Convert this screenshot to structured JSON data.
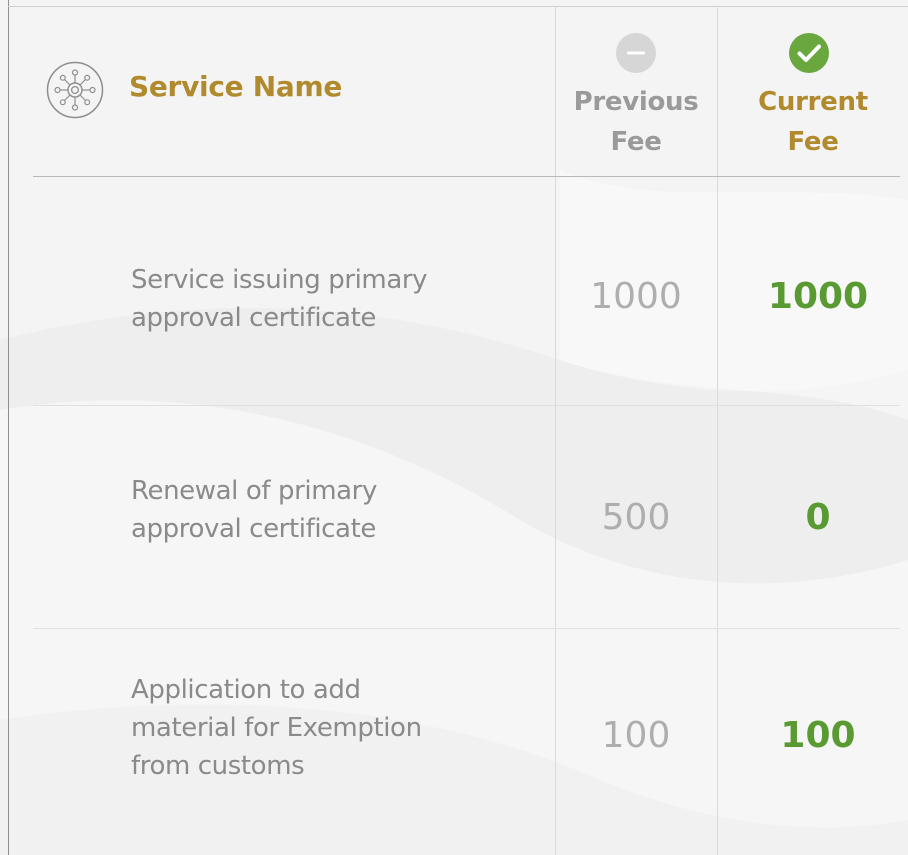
{
  "header": {
    "service_label": "Service Name",
    "previous_fee_label": [
      "Previous",
      "Fee"
    ],
    "current_fee_label": [
      "Current",
      "Fee"
    ]
  },
  "rows": [
    {
      "service_lines": [
        "Service issuing primary",
        "approval certificate"
      ],
      "previous_fee": "1000",
      "current_fee": "1000"
    },
    {
      "service_lines": [
        "Renewal of primary",
        "approval certificate"
      ],
      "previous_fee": "500",
      "current_fee": "0"
    },
    {
      "service_lines": [
        "Application to add",
        "material for Exemption",
        "from customs"
      ],
      "previous_fee": "100",
      "current_fee": "100"
    }
  ],
  "icons": {
    "service": "network-hub-icon",
    "previous": "minus-circle-icon",
    "current": "check-circle-icon"
  },
  "colors": {
    "gold": "#b08a2c",
    "green": "#5a9a33",
    "muted": "#aeaeae",
    "text": "#8a8a8a",
    "minus_circle": "#d6d6d6",
    "check_circle": "#6aa83f"
  }
}
